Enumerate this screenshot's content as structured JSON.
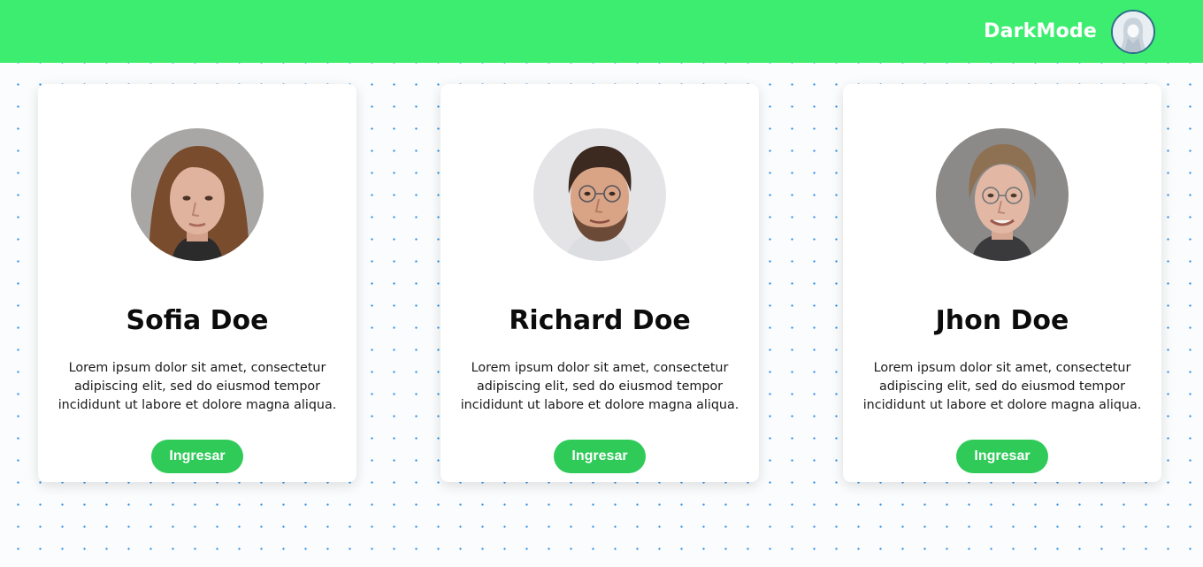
{
  "header": {
    "brand": "DarkMode",
    "avatar_icon": "hooded-user-icon"
  },
  "cards": [
    {
      "name": "Sofia Doe",
      "description": "Lorem ipsum dolor sit amet, consectetur adipiscing elit, sed do eiusmod tempor incididunt ut labore et dolore magna aliqua.",
      "button_label": "Ingresar"
    },
    {
      "name": "Richard Doe",
      "description": "Lorem ipsum dolor sit amet, consectetur adipiscing elit, sed do eiusmod tempor incididunt ut labore et dolore magna aliqua.",
      "button_label": "Ingresar"
    },
    {
      "name": "Jhon Doe",
      "description": "Lorem ipsum dolor sit amet, consectetur adipiscing elit, sed do eiusmod tempor incididunt ut labore et dolore magna aliqua.",
      "button_label": "Ingresar"
    }
  ],
  "colors": {
    "header_bg": "#3ded70",
    "button_bg": "#2fca58",
    "dot_pattern": "#2f8fe8"
  }
}
